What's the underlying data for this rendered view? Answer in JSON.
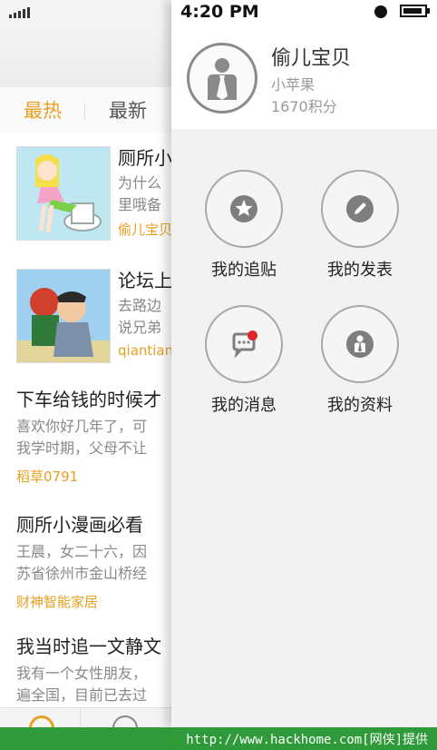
{
  "status_bar": {
    "time": "4:20 PM"
  },
  "feed": {
    "tabs": [
      {
        "label": "最热"
      },
      {
        "label": "最新"
      }
    ],
    "posts": [
      {
        "title": "厕所小",
        "body": [
          "为什么",
          "里哦备"
        ],
        "author": "偷儿宝贝"
      },
      {
        "title": "论坛上",
        "body": [
          "去路边",
          "说兄弟"
        ],
        "author": "qiantian"
      },
      {
        "title": "下车给钱的时候才",
        "body": [
          "喜欢你好几年了，可",
          "我学时期，父母不让"
        ],
        "author": "稻草0791"
      },
      {
        "title": "厕所小漫画必看",
        "body": [
          "王晨，女二十六，因",
          "苏省徐州市金山桥经"
        ],
        "author": "财神智能家居"
      },
      {
        "title": "我当时追一文静文",
        "body": [
          "我有一个女性朋友，",
          "遍全国，目前已去过"
        ]
      }
    ]
  },
  "drawer": {
    "profile": {
      "name": "偷儿宝贝",
      "subtitle": "小苹果",
      "points": "1670积分"
    },
    "menu": [
      {
        "label": "我的追贴",
        "icon": "star-icon"
      },
      {
        "label": "我的发表",
        "icon": "pencil-icon"
      },
      {
        "label": "我的消息",
        "icon": "message-icon"
      },
      {
        "label": "我的资料",
        "icon": "profile-icon"
      }
    ]
  },
  "footer": {
    "text": "http://www.hackhome.com[网侠]提供"
  },
  "colors": {
    "accent": "#e8a020",
    "notification": "#e0252b",
    "watermark_bar": "#2e9a3a"
  }
}
